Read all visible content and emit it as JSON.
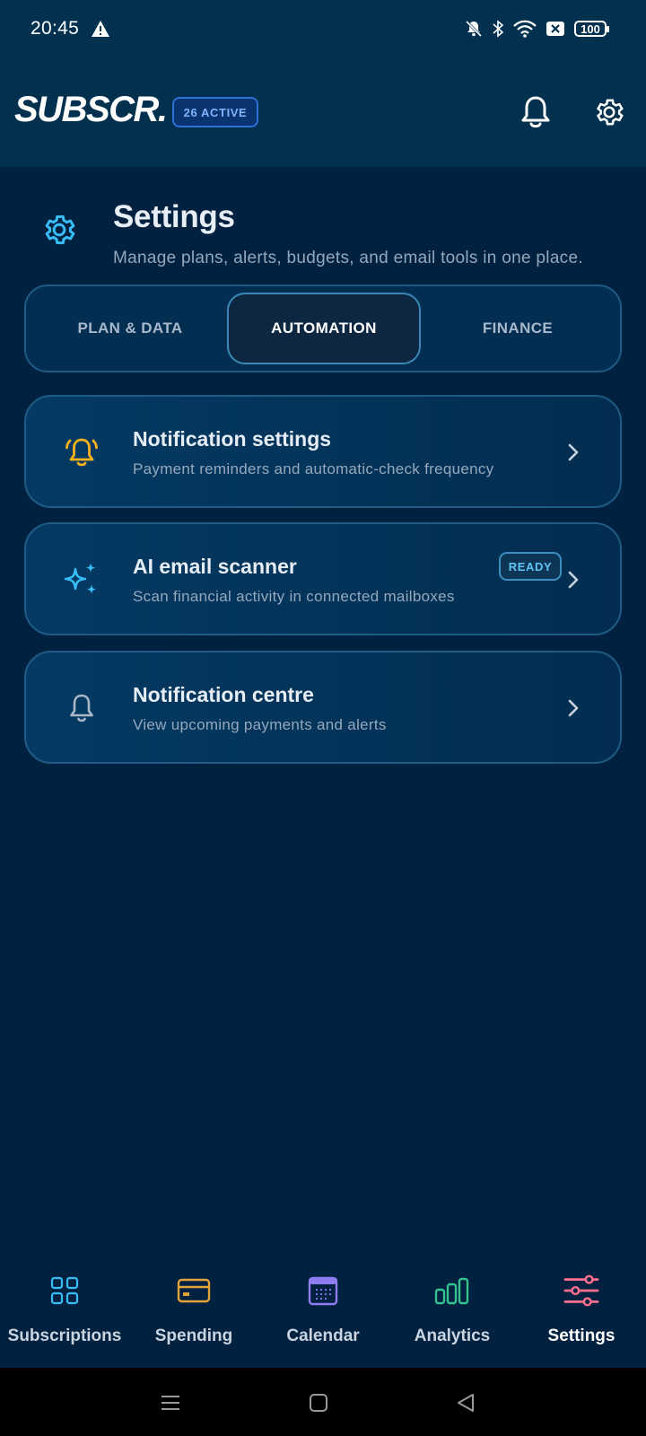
{
  "status_bar": {
    "time": "20:45",
    "battery": "100",
    "icons": [
      "warning-icon",
      "mute-icon",
      "bluetooth-icon",
      "wifi-icon",
      "sim-x-icon",
      "battery-icon"
    ]
  },
  "header": {
    "brand": "SUBSCR.",
    "active_badge": "26 ACTIVE",
    "icons": [
      "bell-icon",
      "gear-icon"
    ]
  },
  "page": {
    "title": "Settings",
    "subtitle": "Manage plans, alerts, budgets, and email tools in one place."
  },
  "tabs": [
    {
      "label": "PLAN & DATA",
      "selected": false
    },
    {
      "label": "AUTOMATION",
      "selected": true
    },
    {
      "label": "FINANCE",
      "selected": false
    }
  ],
  "cards": [
    {
      "title": "Notification settings",
      "description": "Payment reminders and automatic-check frequency",
      "icon": "ringing-bell-icon"
    },
    {
      "title": "AI email scanner",
      "description": "Scan financial activity in connected mailboxes",
      "badge": "READY",
      "icon": "sparkles-icon"
    },
    {
      "title": "Notification centre",
      "description": "View upcoming payments and alerts",
      "icon": "bell-icon"
    }
  ],
  "bottom_nav": [
    {
      "label": "Subscriptions",
      "icon": "grid-icon",
      "active": false
    },
    {
      "label": "Spending",
      "icon": "card-icon",
      "active": false
    },
    {
      "label": "Calendar",
      "icon": "calendar-icon",
      "active": false
    },
    {
      "label": "Analytics",
      "icon": "bar-chart-icon",
      "active": false
    },
    {
      "label": "Settings",
      "icon": "sliders-icon",
      "active": true
    }
  ],
  "colors": {
    "background": "#00213f",
    "header": "#01314f",
    "accent_cyan": "#38bdf8",
    "bell_orange": "#f5b21d",
    "settings_pink": "#ff6f8e"
  }
}
